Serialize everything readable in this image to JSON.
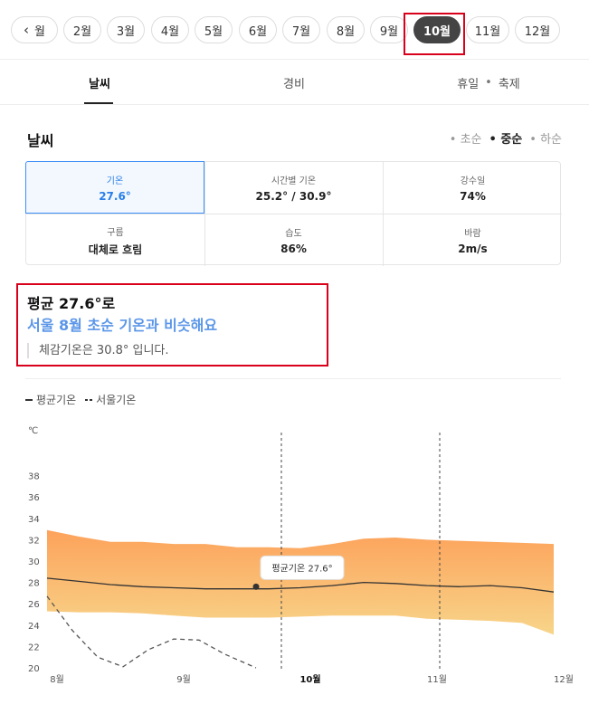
{
  "months": [
    {
      "label": "월",
      "active": false
    },
    {
      "label": "2월",
      "active": false
    },
    {
      "label": "3월",
      "active": false
    },
    {
      "label": "4월",
      "active": false
    },
    {
      "label": "5월",
      "active": false
    },
    {
      "label": "6월",
      "active": false
    },
    {
      "label": "7월",
      "active": false
    },
    {
      "label": "8월",
      "active": false
    },
    {
      "label": "9월",
      "active": false
    },
    {
      "label": "10월",
      "active": true
    },
    {
      "label": "11월",
      "active": false
    },
    {
      "label": "12월",
      "active": false
    }
  ],
  "tabs": {
    "weather": "날씨",
    "cost": "경비",
    "holiday": "휴일",
    "festival": "축제"
  },
  "section": {
    "title": "날씨",
    "periods": [
      "초순",
      "중순",
      "하순"
    ],
    "active_period": "중순"
  },
  "stats": {
    "temp": {
      "label": "기온",
      "value": "27.6°"
    },
    "hourly": {
      "label": "시간별 기온",
      "value": "25.2° / 30.9°"
    },
    "rain": {
      "label": "강수일",
      "value": "74%"
    },
    "cloud": {
      "label": "구름",
      "value": "대체로 흐림"
    },
    "humidity": {
      "label": "습도",
      "value": "86%"
    },
    "wind": {
      "label": "바람",
      "value": "2m/s"
    }
  },
  "summary": {
    "line1": "평균 27.6°로",
    "line2": "서울 8월 초순 기온과 비슷해요",
    "line3": "체감기온은 30.8° 입니다."
  },
  "legend": {
    "avg": "평균기온",
    "seoul": "서울기온"
  },
  "tooltip": "평균기온 27.6°",
  "chart_data": {
    "type": "area",
    "ylabel": "℃",
    "ylim": [
      20,
      40
    ],
    "yticks": [
      20,
      22,
      24,
      26,
      28,
      30,
      32,
      34,
      36,
      38
    ],
    "x_tick_labels": [
      {
        "label": "8월",
        "x": 0
      },
      {
        "label": "9월",
        "x": 1
      },
      {
        "label": "10월",
        "x": 2
      },
      {
        "label": "11월",
        "x": 3
      },
      {
        "label": "12월",
        "x": 4
      }
    ],
    "x": [
      0,
      0.25,
      0.5,
      0.75,
      1,
      1.25,
      1.5,
      1.75,
      2,
      2.25,
      2.5,
      2.75,
      3,
      3.25,
      3.5,
      3.75,
      4
    ],
    "series": [
      {
        "name": "평균기온",
        "role": "avg",
        "values": [
          28.4,
          28.1,
          27.8,
          27.6,
          27.5,
          27.4,
          27.4,
          27.4,
          27.5,
          27.7,
          28.0,
          27.9,
          27.7,
          27.6,
          27.7,
          27.5,
          27.1
        ]
      },
      {
        "name": "서울기온",
        "role": "seoul",
        "x": [
          0,
          0.2,
          0.4,
          0.6,
          0.8,
          1.0,
          1.2,
          1.4,
          1.65
        ],
        "values": [
          26.7,
          23.5,
          21.0,
          20.1,
          21.7,
          22.7,
          22.6,
          21.3,
          20.0
        ]
      }
    ],
    "band": {
      "upper": [
        32.9,
        32.3,
        31.8,
        31.8,
        31.6,
        31.6,
        31.3,
        31.3,
        31.2,
        31.6,
        32.1,
        32.2,
        32.0,
        31.9,
        31.8,
        31.7,
        31.6
      ],
      "lower": [
        25.3,
        25.2,
        25.2,
        25.1,
        24.9,
        24.7,
        24.7,
        24.7,
        24.8,
        24.9,
        24.9,
        24.9,
        24.6,
        24.5,
        24.4,
        24.2,
        23.1
      ]
    },
    "marker": {
      "x": 1.65,
      "y": 27.6
    },
    "vlines": [
      1.85,
      3.1
    ],
    "grid": false
  }
}
